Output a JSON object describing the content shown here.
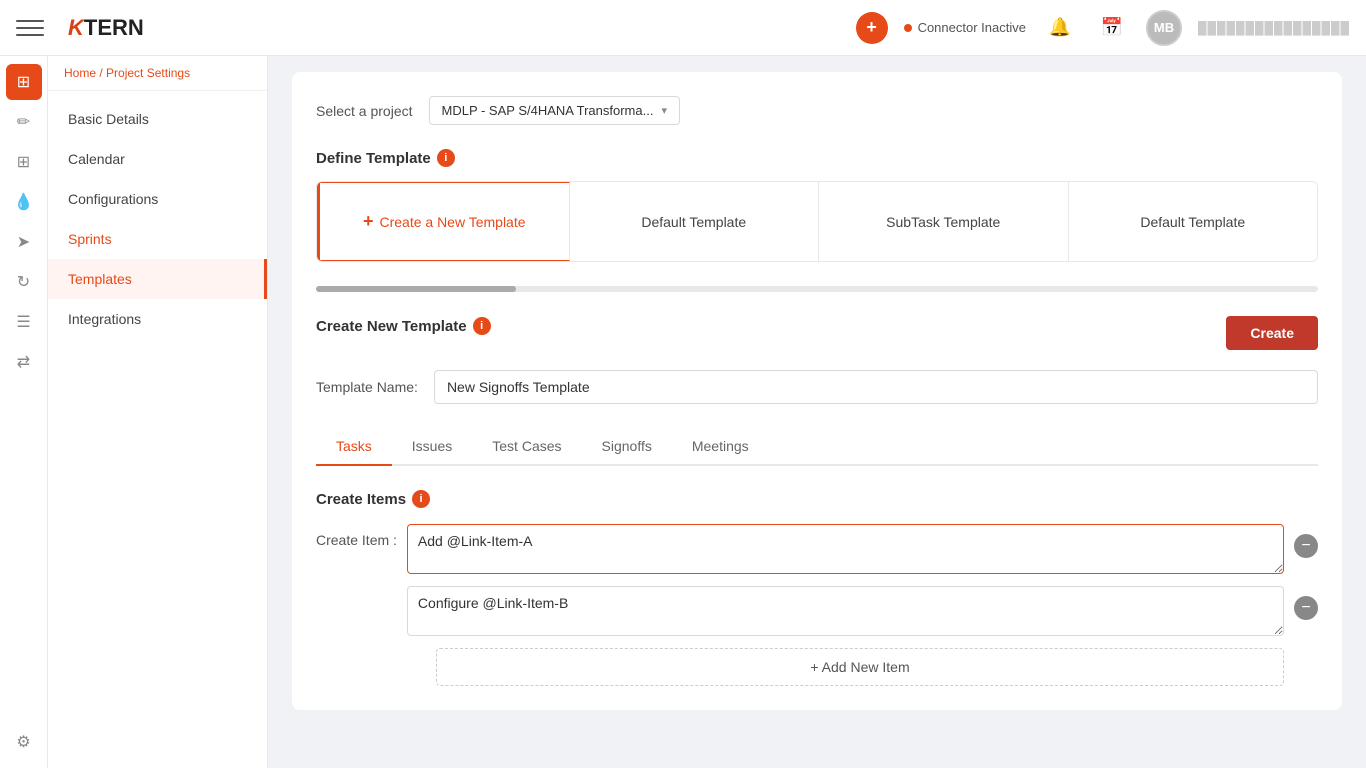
{
  "header": {
    "menu_icon_label": "menu",
    "logo_k": "K",
    "logo_tern": "TERN",
    "add_button_label": "+",
    "connector_status": "Connector Inactive",
    "avatar_initials": "MB",
    "user_text": "████████████████"
  },
  "icon_bar": {
    "items": [
      {
        "name": "home-icon",
        "symbol": "⊞",
        "active": true
      },
      {
        "name": "edit-icon",
        "symbol": "✏",
        "active": false
      },
      {
        "name": "grid-icon",
        "symbol": "⊞",
        "active": false
      },
      {
        "name": "drop-icon",
        "symbol": "💧",
        "active": false
      },
      {
        "name": "send-icon",
        "symbol": "➤",
        "active": false
      },
      {
        "name": "refresh-icon",
        "symbol": "↻",
        "active": false
      },
      {
        "name": "list-icon",
        "symbol": "☰",
        "active": false
      },
      {
        "name": "share-icon",
        "symbol": "⇄",
        "active": false
      }
    ],
    "bottom_items": [
      {
        "name": "settings-icon",
        "symbol": "⚙",
        "active": false
      }
    ]
  },
  "breadcrumb": {
    "home_label": "Home",
    "separator": "/",
    "current": "Project Settings"
  },
  "sidebar": {
    "items": [
      {
        "label": "Basic Details",
        "active": false
      },
      {
        "label": "Calendar",
        "active": false
      },
      {
        "label": "Configurations",
        "active": false
      },
      {
        "label": "Sprints",
        "active": false
      },
      {
        "label": "Templates",
        "active": true
      },
      {
        "label": "Integrations",
        "active": false
      }
    ]
  },
  "content": {
    "select_project_label": "Select a project",
    "project_dropdown_value": "MDLP - SAP S/4HANA Transforma...",
    "define_template_title": "Define Template",
    "template_cards": [
      {
        "label": "Create a New Template",
        "is_add": true
      },
      {
        "label": "Default Template"
      },
      {
        "label": "SubTask Template"
      },
      {
        "label": "Default Template"
      }
    ],
    "create_new_template_title": "Create New Template",
    "create_button_label": "Create",
    "template_name_label": "Template Name:",
    "template_name_value": "New Signoffs Template",
    "tabs": [
      {
        "label": "Tasks",
        "active": true
      },
      {
        "label": "Issues",
        "active": false
      },
      {
        "label": "Test Cases",
        "active": false
      },
      {
        "label": "Signoffs",
        "active": false
      },
      {
        "label": "Meetings",
        "active": false
      }
    ],
    "create_items_title": "Create Items",
    "create_item_label": "Create Item :",
    "items": [
      {
        "value": "Add @Link-Item-A",
        "active": true
      },
      {
        "value": "Configure @Link-Item-B",
        "active": false
      }
    ],
    "add_new_item_label": "+ Add New Item"
  }
}
